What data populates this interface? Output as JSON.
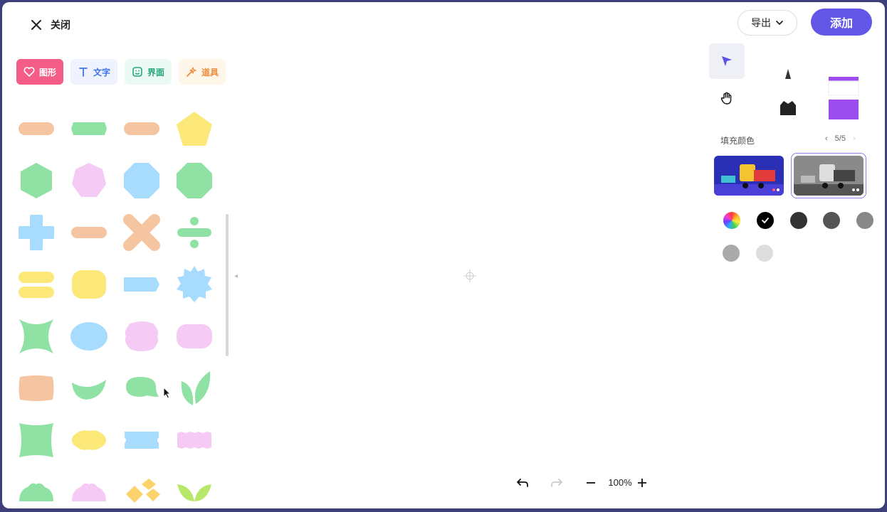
{
  "header": {
    "close_label": "关闭",
    "export_label": "导出",
    "add_label": "添加"
  },
  "tabs": [
    {
      "label": "图形",
      "icon": "heart-icon",
      "active": true
    },
    {
      "label": "文字",
      "icon": "text-icon"
    },
    {
      "label": "界面",
      "icon": "sticker-icon"
    },
    {
      "label": "道具",
      "icon": "magic-wand-icon"
    }
  ],
  "shapes": [
    "rounded-rect-orange",
    "rounded-rect-green",
    "rounded-rect-orange",
    "pentagon-yellow",
    "hexagon-green",
    "heptagon-pink",
    "octagon-blue",
    "octagon-green",
    "plus-blue",
    "minus-orange",
    "cross-orange",
    "divide-green",
    "equals-yellow",
    "rounded-square-yellow",
    "tag-blue",
    "starburst-blue",
    "star4-green",
    "cloud-blue",
    "cloud-pink",
    "rounded-rect-pink",
    "wavy-orange",
    "leaf-green",
    "speech-bubble-green",
    "leaves-green",
    "wavy-square-green",
    "blob-yellow",
    "ticket-blue",
    "ribbon-pink",
    "scallop-green",
    "scallop-pink",
    "shapes-yellow",
    "sprout-lime"
  ],
  "panel": {
    "fill_color_label": "填充颜色",
    "pager_text": "5/5",
    "swatch_colors": [
      "rainbow",
      "#000000",
      "#333333",
      "#555555",
      "#888888",
      "#aaaaaa",
      "#dddddd"
    ]
  },
  "toolbar": {
    "zoom_label": "100%"
  }
}
